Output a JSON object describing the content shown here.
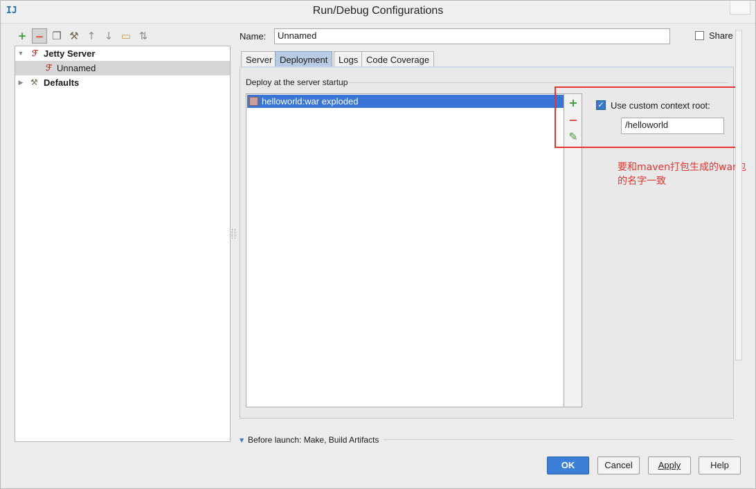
{
  "window": {
    "title": "Run/Debug Configurations",
    "app_icon_text": "IJ"
  },
  "toolbar": {
    "items": [
      {
        "icon": "plus-icon",
        "glyph": "+",
        "color": "#3a9b3a"
      },
      {
        "icon": "minus-icon",
        "glyph": "−",
        "color": "#d9412f"
      },
      {
        "icon": "copy-icon",
        "glyph": "❐",
        "color": "#5a6a7a"
      },
      {
        "icon": "wrench-icon",
        "glyph": "⚒",
        "color": "#7a6a4a"
      },
      {
        "icon": "arrow-up-icon",
        "glyph": "↑",
        "color": "#8a8a8a"
      },
      {
        "icon": "arrow-down-icon",
        "glyph": "↓",
        "color": "#8a8a8a"
      },
      {
        "icon": "folder-icon",
        "glyph": "▭",
        "color": "#c49a3a"
      },
      {
        "icon": "sort-icon",
        "glyph": "⇅",
        "color": "#8a8a8a"
      }
    ]
  },
  "tree": {
    "items": [
      {
        "label": "Jetty Server",
        "level": 0,
        "expanded": true,
        "bold": true,
        "icon": "jetty-icon"
      },
      {
        "label": "Unnamed",
        "level": 1,
        "selected": true,
        "icon": "jetty-icon"
      },
      {
        "label": "Defaults",
        "level": 0,
        "expanded": false,
        "bold": true,
        "icon": "wrench-icon"
      }
    ]
  },
  "name_field": {
    "label": "Name:",
    "value": "Unnamed"
  },
  "share": {
    "label": "Share",
    "checked": false
  },
  "tabs": [
    {
      "label": "Server",
      "active": false
    },
    {
      "label": "Deployment",
      "active": true
    },
    {
      "label": "Logs",
      "active": false
    },
    {
      "label": "Code Coverage",
      "active": false
    }
  ],
  "deployment": {
    "section_label": "Deploy at the server startup",
    "artifacts": [
      {
        "label": "helloworld:war exploded",
        "selected": true
      }
    ],
    "side_tools": [
      {
        "icon": "add-icon",
        "glyph": "+",
        "color": "#3a9b3a"
      },
      {
        "icon": "remove-icon",
        "glyph": "−",
        "color": "#d9412f"
      },
      {
        "icon": "edit-icon",
        "glyph": "✎",
        "color": "#4a9a3a"
      }
    ],
    "custom_context": {
      "label": "Use custom context root:",
      "checked": true,
      "value": "/helloworld"
    }
  },
  "annotation": {
    "text": "要和maven打包生成的war包的名字一致",
    "color": "#e8342d"
  },
  "before_launch": {
    "label": "Before launch: Make, Build Artifacts"
  },
  "buttons": {
    "ok": "OK",
    "cancel": "Cancel",
    "apply": "Apply",
    "help": "Help"
  },
  "colors": {
    "accent": "#3c7fd8",
    "selection": "#3875d7",
    "annotation": "#e8342d"
  }
}
